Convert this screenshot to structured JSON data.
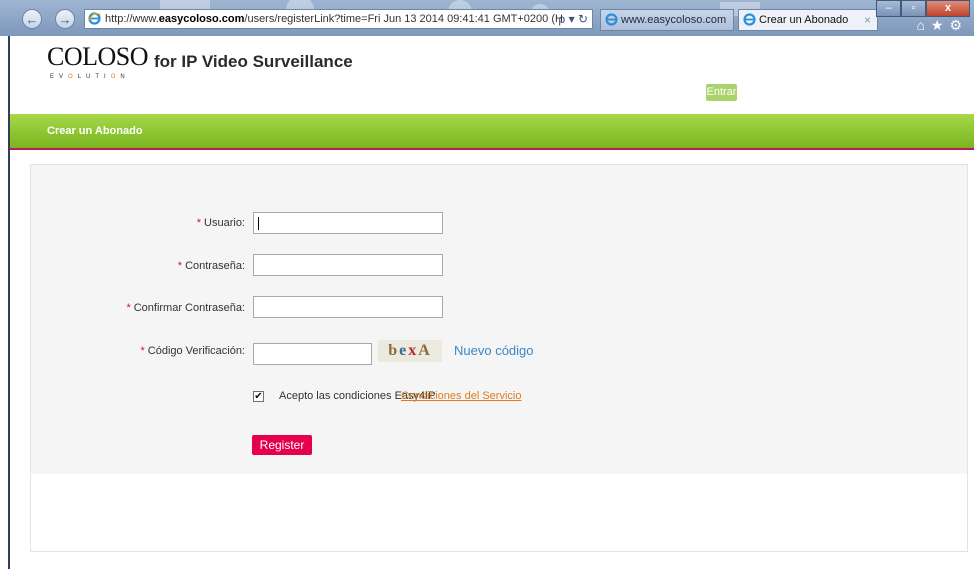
{
  "browser": {
    "address_url_prefix": "http://www.",
    "address_url_domain": "easycoloso.com",
    "address_url_rest": "/users/registerLink?time=Fri Jun 13 2014 09:41:41 GMT+0200 (H",
    "address_tools": "ρ ▾ ↻",
    "tabs": [
      {
        "label": "www.easycoloso.com"
      },
      {
        "label": "Crear un Abonado"
      }
    ],
    "tab_close": "×",
    "window_buttons": {
      "minimize": "–",
      "maximize": "▫",
      "close": "x"
    },
    "toolbar_icons": "⌂★⚙"
  },
  "header": {
    "logo": "COLOSO",
    "logo_sub_a": "EV",
    "logo_sub_o": "O",
    "logo_sub_b": "LUTI",
    "logo_sub_o2": "O",
    "logo_sub_c": "N",
    "tagline": "for IP Video Surveillance",
    "login_button": "Entrar"
  },
  "page_bar": {
    "title": "Crear un Abonado"
  },
  "form": {
    "required_mark": "*",
    "fields": [
      {
        "label": "Usuario:",
        "value": ""
      },
      {
        "label": "Contraseña:",
        "value": ""
      },
      {
        "label": "Confirmar Contraseña:",
        "value": ""
      },
      {
        "label": "Código Verificación:",
        "value": ""
      }
    ],
    "captcha": {
      "c1": "b",
      "c2": "e",
      "c3": "x",
      "c4": "A"
    },
    "new_code_link": "Nuevo código",
    "accept_checked": true,
    "accept_check_mark": "✔",
    "accept_text": "Acepto las condiciones Easy4IP",
    "terms_link": "Condiciones del Servicio",
    "submit_label": "Register"
  },
  "colors": {
    "bar_green": "#8cc63f",
    "accent_pink": "#e5004f",
    "link_blue": "#3b86c6",
    "link_orange": "#e07a1c"
  }
}
